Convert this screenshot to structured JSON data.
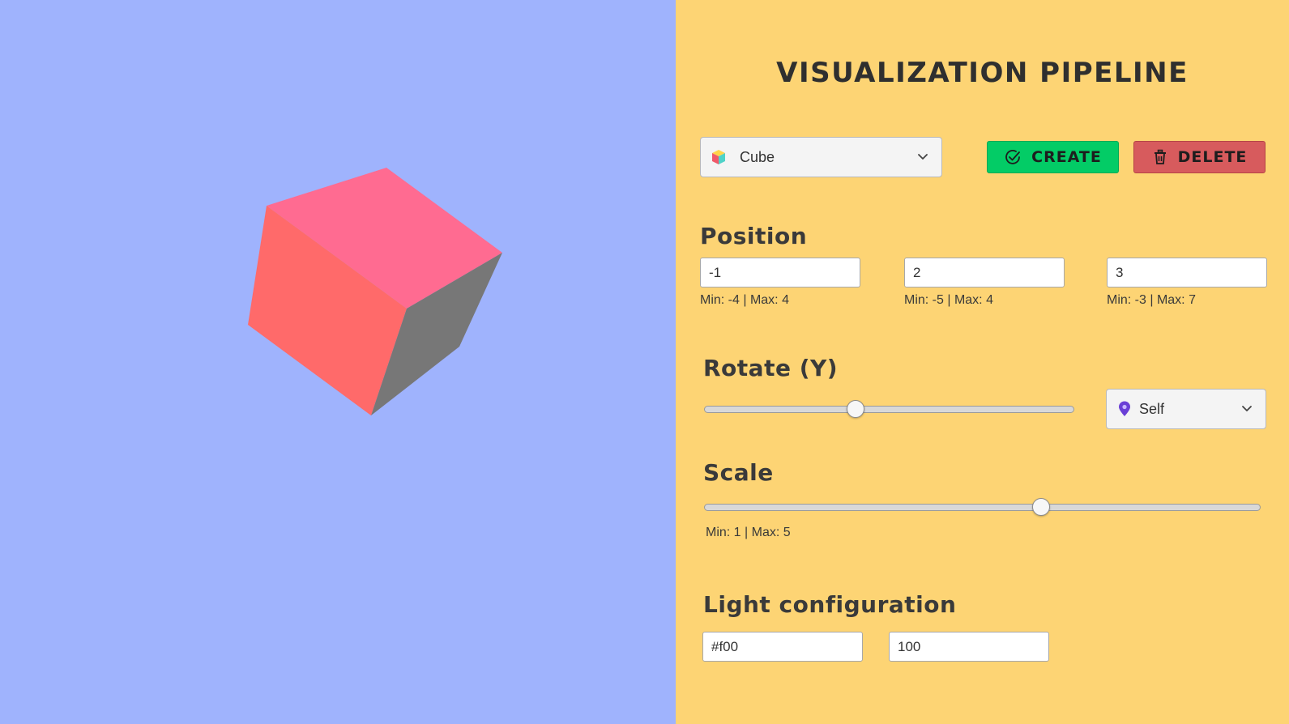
{
  "panel": {
    "title": "VISUALIZATION PIPELINE",
    "shape_select": {
      "value": "Cube",
      "icon": "cube-icon"
    },
    "create_label": "CREATE",
    "delete_label": "DELETE",
    "position": {
      "heading": "Position",
      "x": {
        "value": "-1",
        "hint": "Min: -4 | Max: 4"
      },
      "y": {
        "value": "2",
        "hint": "Min: -5 | Max: 4"
      },
      "z": {
        "value": "3",
        "hint": "Min: -3 | Max: 7"
      }
    },
    "rotate": {
      "heading": "Rotate (Y)",
      "slider_fraction": 0.41,
      "space_select": {
        "value": "Self",
        "icon": "location-pin-icon"
      }
    },
    "scale": {
      "heading": "Scale",
      "slider_fraction": 0.605,
      "hint": "Min: 1 | Max: 5"
    },
    "light": {
      "heading": "Light configuration",
      "color": "#f00",
      "intensity": "100"
    }
  },
  "colors": {
    "viewport_bg": "#9fb3fd",
    "panel_bg": "#fdd474",
    "create_button": "#03cc66",
    "delete_button": "#d75b5d",
    "cube_top": "#ff6b91",
    "cube_left": "#ff6a6a",
    "cube_right": "#777777"
  }
}
